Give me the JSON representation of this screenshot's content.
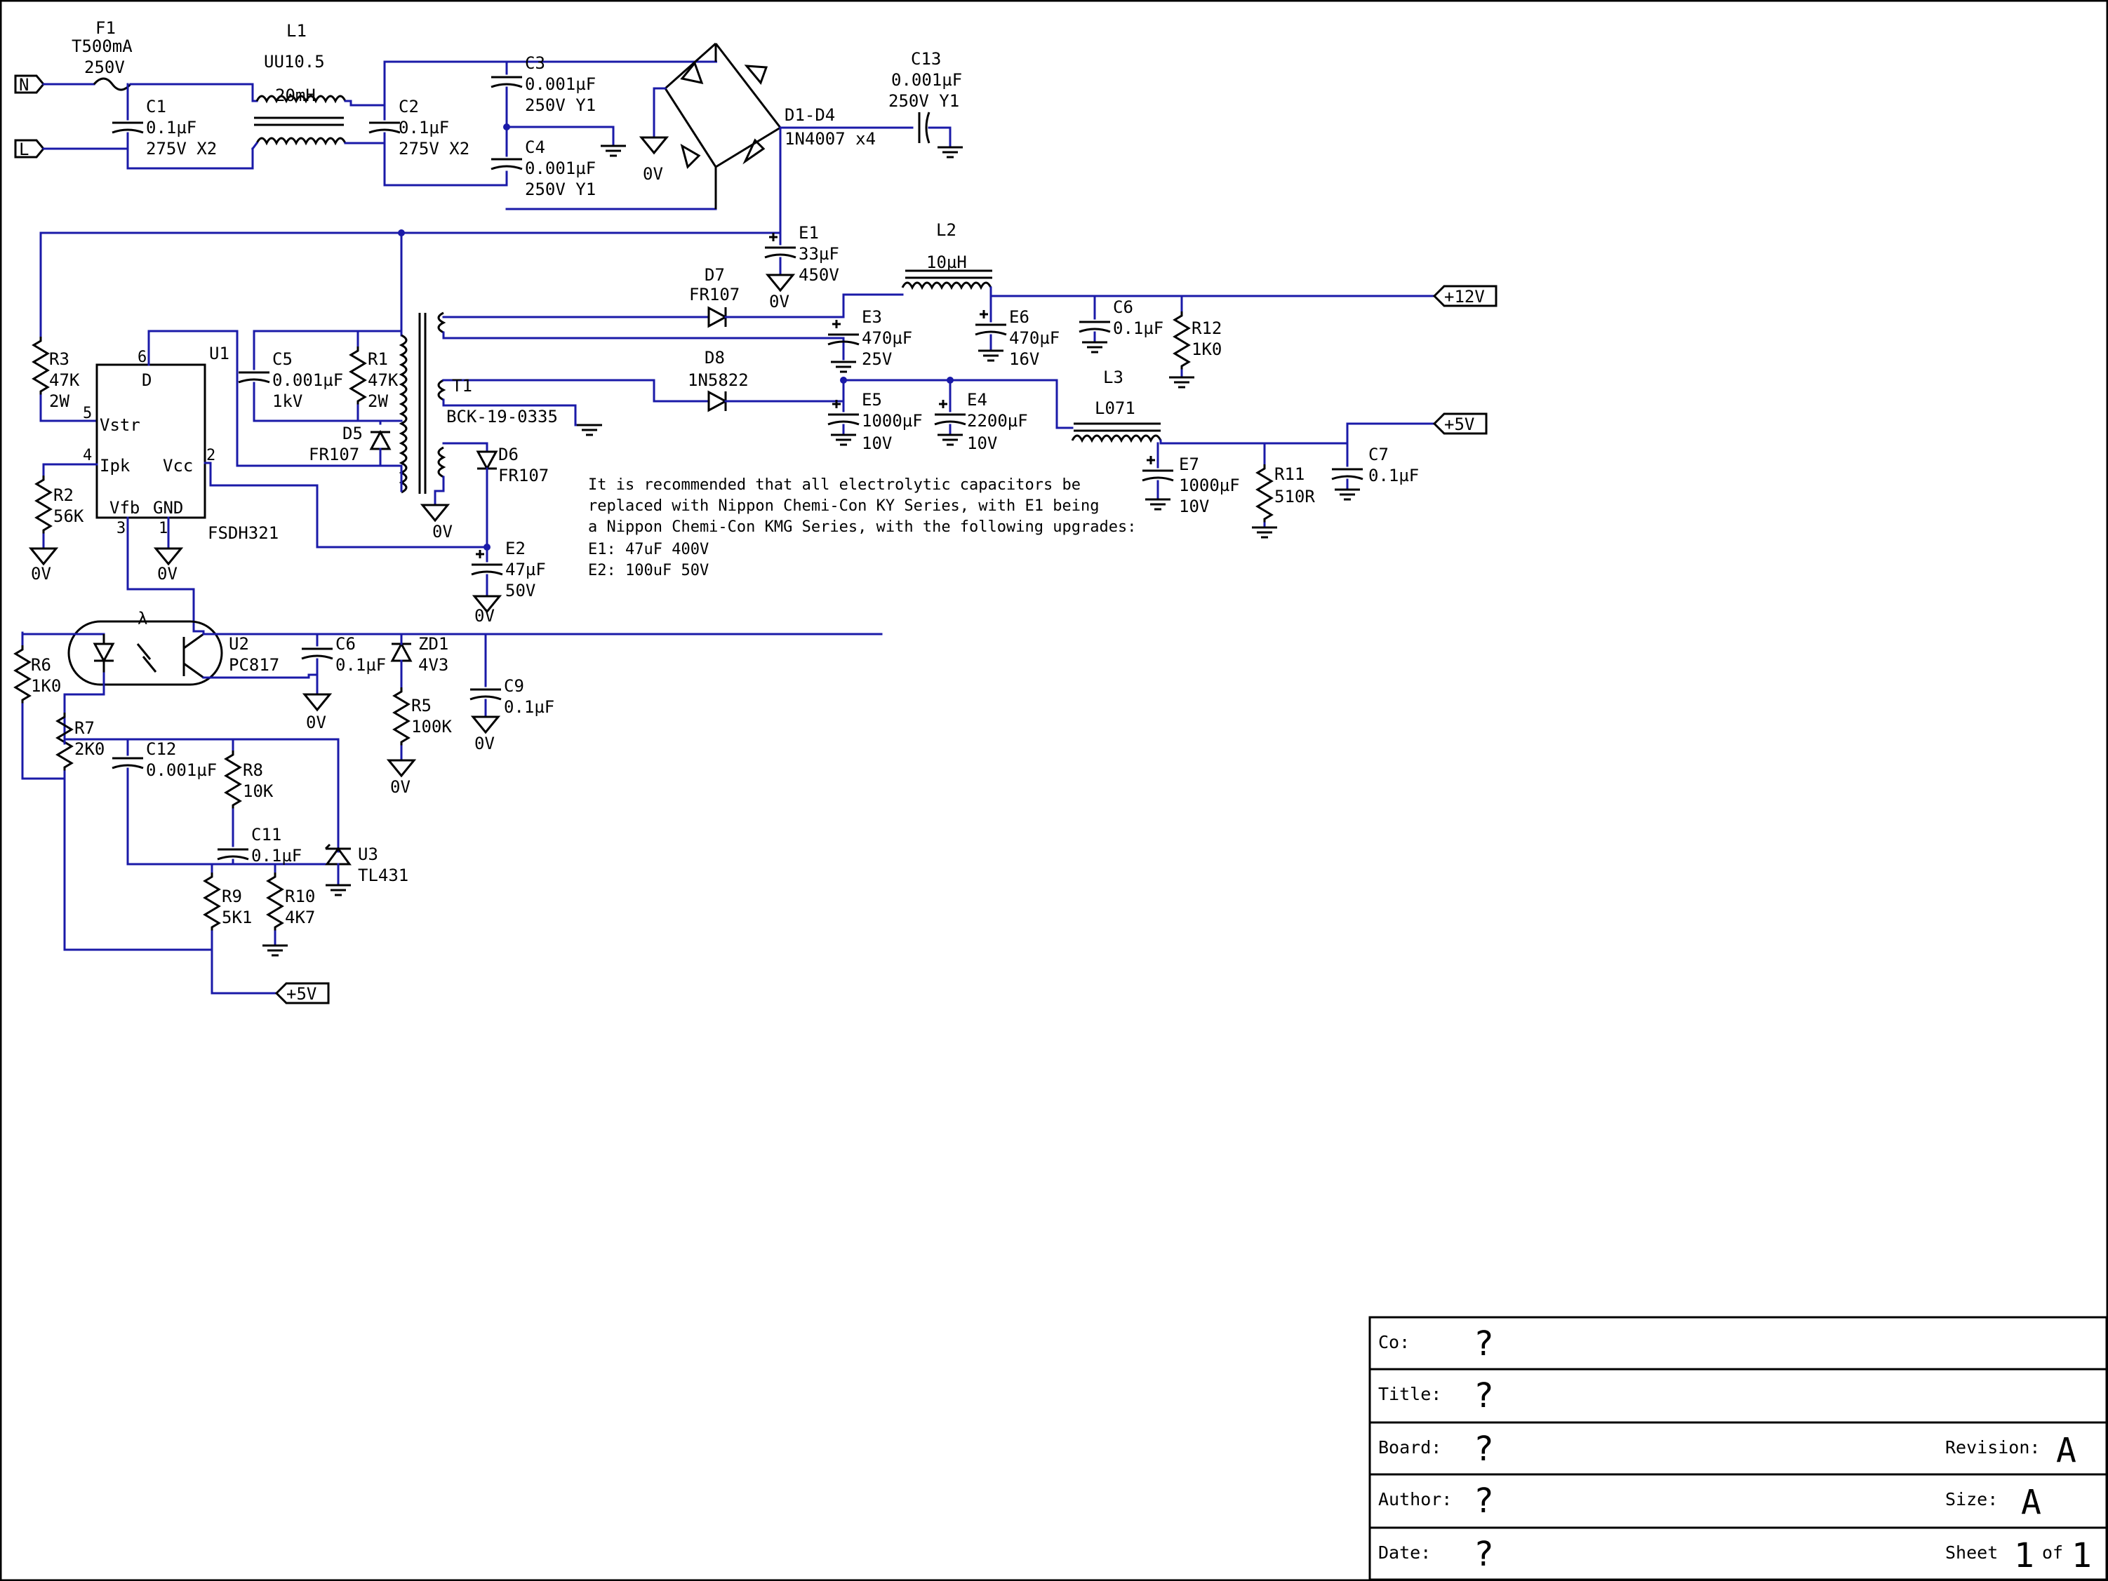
{
  "components": {
    "F1": {
      "ref": "F1",
      "v1": "T500mA",
      "v2": "250V"
    },
    "L1": {
      "ref": "L1",
      "v1": "UU10.5",
      "v2": "20mH"
    },
    "C1": {
      "ref": "C1",
      "v1": "0.1µF",
      "v2": "275V X2"
    },
    "C2": {
      "ref": "C2",
      "v1": "0.1µF",
      "v2": "275V X2"
    },
    "C3": {
      "ref": "C3",
      "v1": "0.001µF",
      "v2": "250V Y1"
    },
    "C4": {
      "ref": "C4",
      "v1": "0.001µF",
      "v2": "250V Y1"
    },
    "D1": {
      "ref": "D1-D4",
      "v1": "1N4007 x4"
    },
    "C13": {
      "ref": "C13",
      "v1": "0.001µF",
      "v2": "250V Y1"
    },
    "E1": {
      "ref": "E1",
      "v1": "33µF",
      "v2": "450V"
    },
    "L2": {
      "ref": "L2",
      "v1": "10µH"
    },
    "D7": {
      "ref": "D7",
      "v1": "FR107"
    },
    "D8": {
      "ref": "D8",
      "v1": "1N5822"
    },
    "E3": {
      "ref": "E3",
      "v1": "470µF",
      "v2": "25V"
    },
    "E6": {
      "ref": "E6",
      "v1": "470µF",
      "v2": "16V"
    },
    "C6a": {
      "ref": "C6",
      "v1": "0.1µF"
    },
    "R12": {
      "ref": "R12",
      "v1": "1K0"
    },
    "T1": {
      "ref": "T1",
      "v1": "BCK-19-0335"
    },
    "E5": {
      "ref": "E5",
      "v1": "1000µF",
      "v2": "10V"
    },
    "E4": {
      "ref": "E4",
      "v1": "2200µF",
      "v2": "10V"
    },
    "L3": {
      "ref": "L3",
      "v1": "L071"
    },
    "E7": {
      "ref": "E7",
      "v1": "1000µF",
      "v2": "10V"
    },
    "R11": {
      "ref": "R11",
      "v1": "510R"
    },
    "C7": {
      "ref": "C7",
      "v1": "0.1µF"
    },
    "R3": {
      "ref": "R3",
      "v1": "47K",
      "v2": "2W"
    },
    "U1": {
      "ref": "U1",
      "part": "FSDH321",
      "pin_d": "D",
      "pin_vstr": "Vstr",
      "pin_ipk": "Ipk",
      "pin_vcc": "Vcc",
      "pin_vfb": "Vfb",
      "pin_gnd": "GND",
      "n1": "1",
      "n2": "2",
      "n3": "3",
      "n4": "4",
      "n5": "5",
      "n6": "6"
    },
    "C5": {
      "ref": "C5",
      "v1": "0.001µF",
      "v2": "1kV"
    },
    "R1": {
      "ref": "R1",
      "v1": "47K",
      "v2": "2W"
    },
    "D5": {
      "ref": "D5",
      "v1": "FR107"
    },
    "D6": {
      "ref": "D6",
      "v1": "FR107"
    },
    "R2": {
      "ref": "R2",
      "v1": "56K"
    },
    "E2": {
      "ref": "E2",
      "v1": "47µF",
      "v2": "50V"
    },
    "U2": {
      "ref": "U2",
      "v1": "PC817",
      "lambda": "λ"
    },
    "C6b": {
      "ref": "C6",
      "v1": "0.1µF"
    },
    "ZD1": {
      "ref": "ZD1",
      "v1": "4V3"
    },
    "R5": {
      "ref": "R5",
      "v1": "100K"
    },
    "C9": {
      "ref": "C9",
      "v1": "0.1µF"
    },
    "R6": {
      "ref": "R6",
      "v1": "1K0"
    },
    "R7": {
      "ref": "R7",
      "v1": "2K0"
    },
    "C12": {
      "ref": "C12",
      "v1": "0.001µF"
    },
    "R8": {
      "ref": "R8",
      "v1": "10K"
    },
    "C11": {
      "ref": "C11",
      "v1": "0.1µF"
    },
    "U3": {
      "ref": "U3",
      "v1": "TL431"
    },
    "R9": {
      "ref": "R9",
      "v1": "5K1"
    },
    "R10": {
      "ref": "R10",
      "v1": "4K7"
    }
  },
  "ports": {
    "n": "N",
    "l": "L",
    "p12": "+12V",
    "p5a": "+5V",
    "p5b": "+5V"
  },
  "ground_label": "0V",
  "note": {
    "l1": "It is recommended that all electrolytic capacitors be",
    "l2": "replaced with Nippon Chemi-Con KY Series, with E1 being",
    "l3": "a Nippon Chemi-Con KMG Series, with the following upgrades:",
    "l4": "E1: 47uF 400V",
    "l5": "E2: 100uF 50V"
  },
  "title_block": {
    "co_label": "Co:",
    "co_value": "?",
    "title_label": "Title:",
    "title_value": "?",
    "board_label": "Board:",
    "board_value": "?",
    "author_label": "Author:",
    "author_value": "?",
    "date_label": "Date:",
    "date_value": "?",
    "revision_label": "Revision:",
    "revision_value": "A",
    "size_label": "Size:",
    "size_value": "A",
    "sheet_label": "Sheet",
    "sheet_num": "1",
    "of_label": "of",
    "sheet_total": "1"
  }
}
